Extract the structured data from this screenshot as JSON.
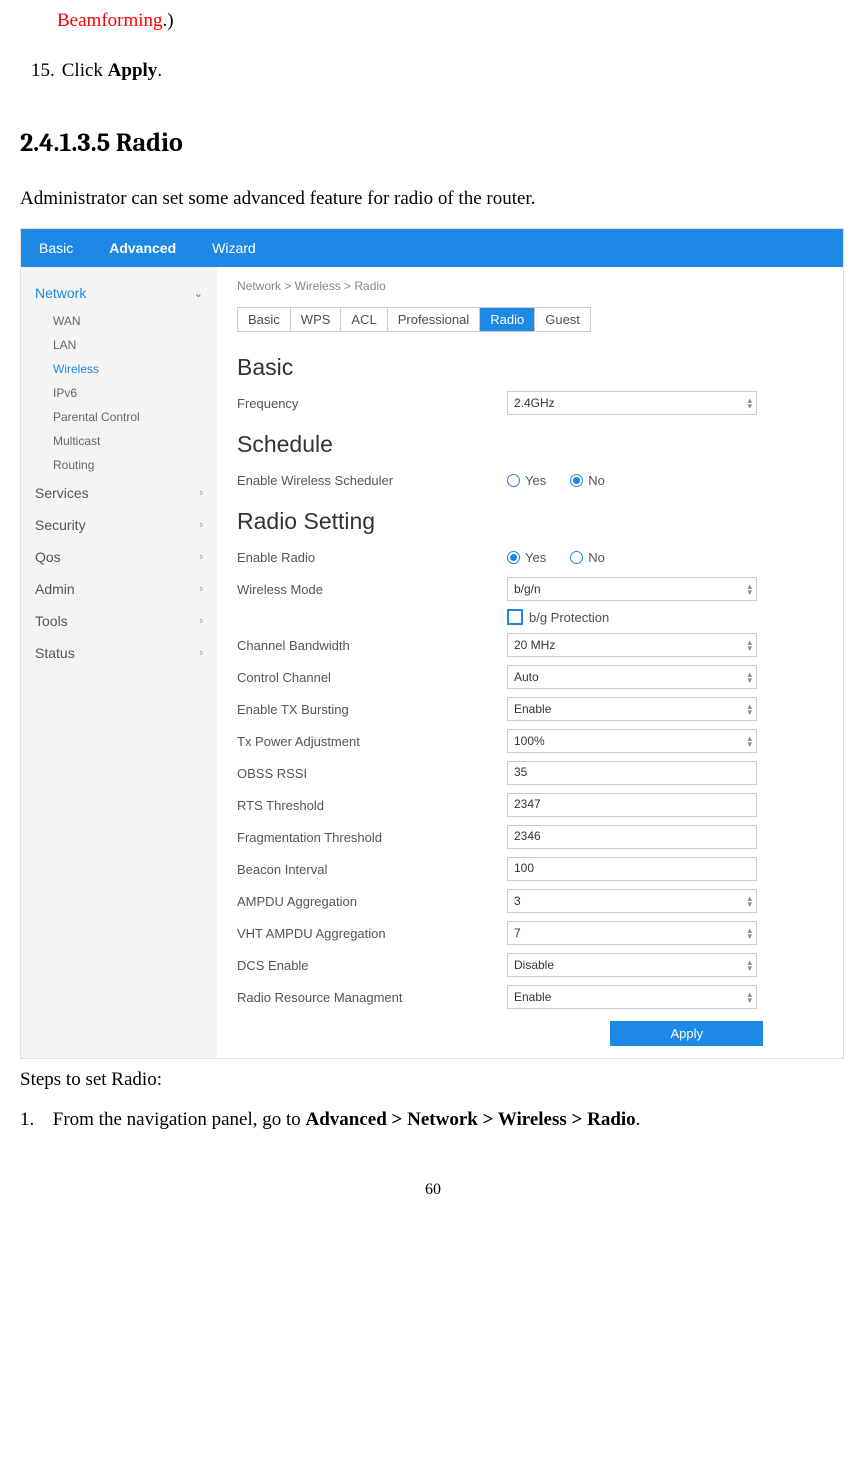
{
  "top_fragment_red": "Beamforming",
  "top_fragment_rest": ".)",
  "step15_num": "15.",
  "step15_pre": "Click ",
  "step15_bold": "Apply",
  "step15_post": ".",
  "section_heading": "2.4.1.3.5  Radio",
  "intro": "Administrator can set some advanced feature for radio of the router.",
  "screenshot": {
    "topbar": {
      "basic": "Basic",
      "advanced": "Advanced",
      "wizard": "Wizard"
    },
    "sidebar": {
      "network": "Network",
      "sub": {
        "wan": "WAN",
        "lan": "LAN",
        "wireless": "Wireless",
        "ipv6": "IPv6",
        "parental": "Parental Control",
        "multicast": "Multicast",
        "routing": "Routing"
      },
      "services": "Services",
      "security": "Security",
      "qos": "Qos",
      "admin": "Admin",
      "tools": "Tools",
      "status": "Status"
    },
    "breadcrumb": "Network > Wireless > Radio",
    "tabs": {
      "basic": "Basic",
      "wps": "WPS",
      "acl": "ACL",
      "professional": "Professional",
      "radio": "Radio",
      "guest": "Guest"
    },
    "sections": {
      "basic": {
        "title": "Basic",
        "frequency_label": "Frequency",
        "frequency_value": "2.4GHz"
      },
      "schedule": {
        "title": "Schedule",
        "enable_label": "Enable Wireless Scheduler",
        "yes": "Yes",
        "no": "No"
      },
      "radio": {
        "title": "Radio Setting",
        "enable_radio": "Enable Radio",
        "yes": "Yes",
        "no": "No",
        "wireless_mode": "Wireless Mode",
        "wireless_mode_value": "b/g/n",
        "bg_protection": "b/g Protection",
        "channel_bw": "Channel Bandwidth",
        "channel_bw_value": "20 MHz",
        "control_channel": "Control Channel",
        "control_channel_value": "Auto",
        "tx_bursting": "Enable TX Bursting",
        "tx_bursting_value": "Enable",
        "tx_power": "Tx Power Adjustment",
        "tx_power_value": "100%",
        "obss_rssi": "OBSS RSSI",
        "obss_rssi_value": "35",
        "rts": "RTS Threshold",
        "rts_value": "2347",
        "frag": "Fragmentation Threshold",
        "frag_value": "2346",
        "beacon": "Beacon Interval",
        "beacon_value": "100",
        "ampdu": "AMPDU Aggregation",
        "ampdu_value": "3",
        "vht_ampdu": "VHT AMPDU Aggregation",
        "vht_ampdu_value": "7",
        "dcs": "DCS Enable",
        "dcs_value": "Disable",
        "rrm": "Radio Resource Managment",
        "rrm_value": "Enable"
      }
    },
    "apply": "Apply"
  },
  "steps_label": "Steps to set Radio:",
  "step1_num": "1.",
  "step1_text_pre": "From the navigation panel, go to ",
  "step1_bold": "Advanced > Network > Wireless > Radio",
  "step1_post": ".",
  "page_num": "60"
}
